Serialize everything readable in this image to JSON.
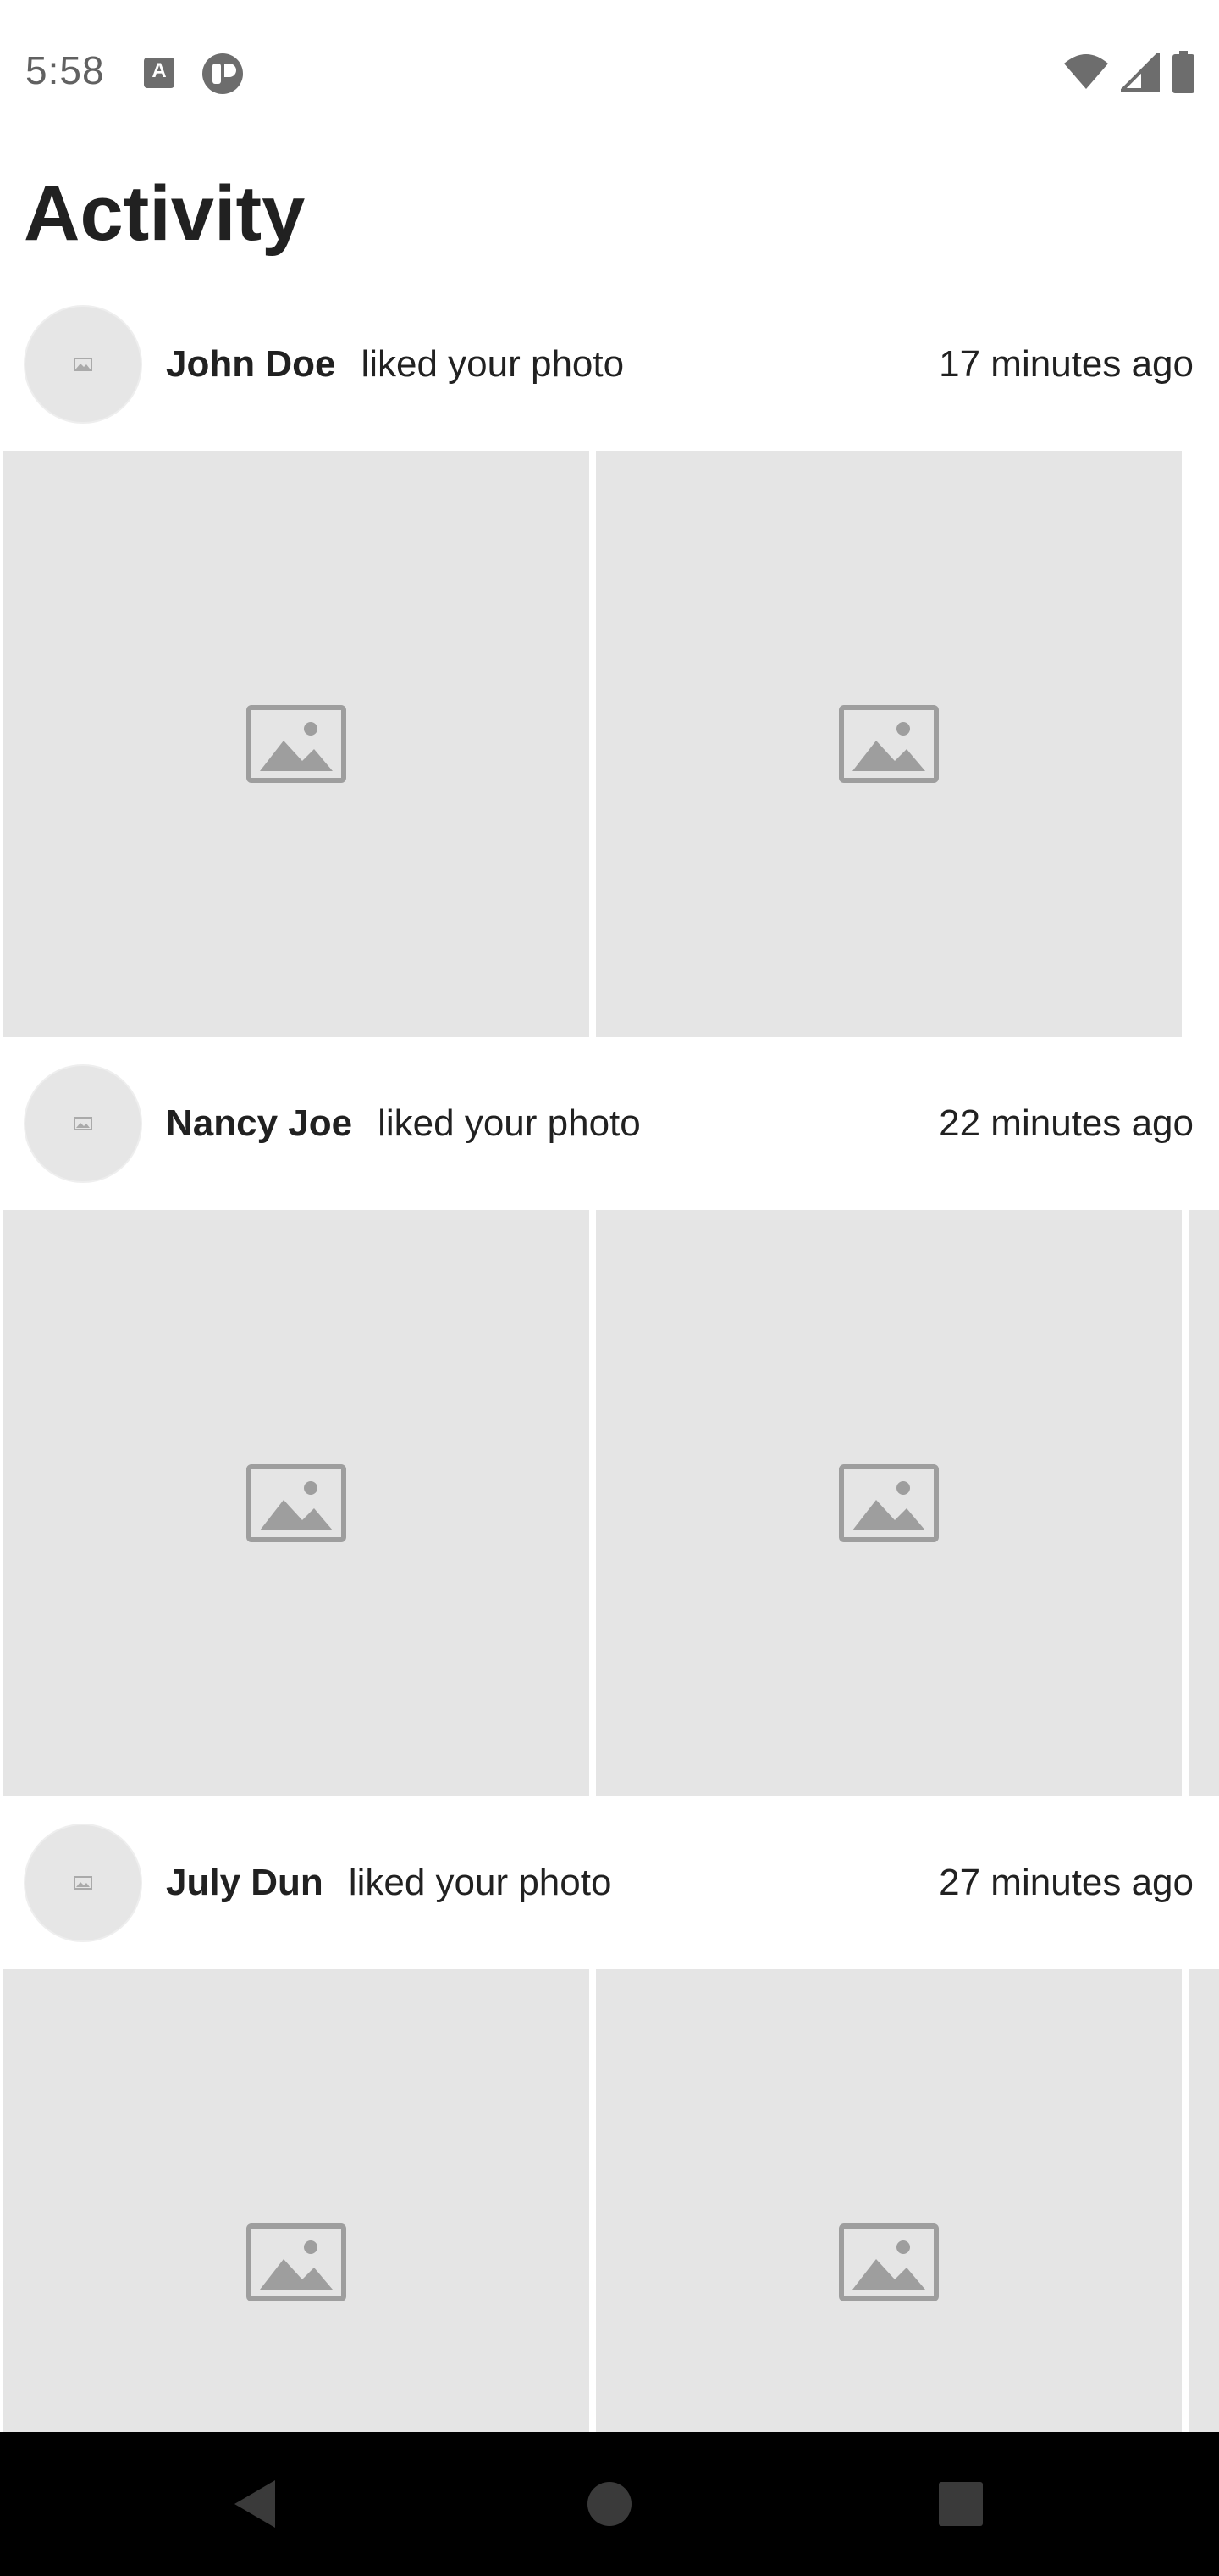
{
  "status_bar": {
    "time": "5:58",
    "icons": [
      "text-a-icon",
      "circle-t-icon",
      "wifi-icon",
      "cell-signal-icon",
      "battery-icon"
    ]
  },
  "page": {
    "title": "Activity"
  },
  "activities": [
    {
      "name": "John Doe",
      "action": "liked your photo",
      "time": "17 minutes ago"
    },
    {
      "name": "Nancy Joe",
      "action": "liked your photo",
      "time": "22 minutes ago"
    },
    {
      "name": "July Dun",
      "action": "liked your photo",
      "time": "27 minutes ago"
    }
  ],
  "colors": {
    "placeholder_bg": "#e5e5e5",
    "placeholder_icon": "#9e9e9e",
    "nav_bar": "#000000",
    "text": "#212121"
  },
  "nav_bar": {
    "buttons": [
      "back-icon",
      "home-icon",
      "recents-icon"
    ]
  }
}
